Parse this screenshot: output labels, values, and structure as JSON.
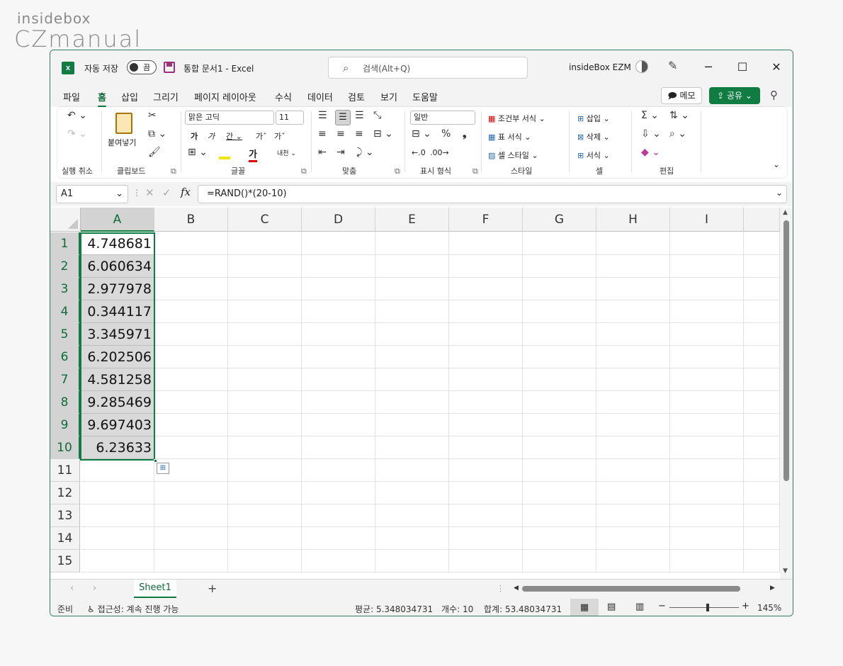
{
  "watermark": {
    "line1": "insidebox",
    "line2": "CZmanual"
  },
  "titlebar": {
    "autosave_label": "자동 저장",
    "autosave_state": "끔",
    "doc_title": "통합 문서1  -  Excel",
    "search_placeholder": "검색(Alt+Q)",
    "user": "insideBox EZM"
  },
  "menu": {
    "items": [
      "파일",
      "홈",
      "삽입",
      "그리기",
      "페이지 레이아웃",
      "수식",
      "데이터",
      "검토",
      "보기",
      "도움말"
    ],
    "active": "홈",
    "memo_label": "메모",
    "share_label": "공유"
  },
  "ribbon": {
    "paste_label": "붙여넣기",
    "font_name": "맑은 고딕",
    "font_size": "11",
    "number_format": "일반",
    "conditional_format": "조건부 서식",
    "table_format": "표 서식",
    "cell_style": "셀 스타일",
    "insert": "삽입",
    "delete": "삭제",
    "format": "서식",
    "groups": [
      "실행 취소",
      "클립보드",
      "글꼴",
      "맞춤",
      "표시 형식",
      "스타일",
      "셀",
      "편집"
    ]
  },
  "formula_bar": {
    "name_box": "A1",
    "formula": "=RAND()*(20-10)"
  },
  "grid": {
    "columns": [
      "A",
      "B",
      "C",
      "D",
      "E",
      "F",
      "G",
      "H",
      "I"
    ],
    "rows": [
      "1",
      "2",
      "3",
      "4",
      "5",
      "6",
      "7",
      "8",
      "9",
      "10",
      "11",
      "12",
      "13",
      "14",
      "15"
    ],
    "a_values": [
      "4.748681",
      "6.060634",
      "2.977978",
      "0.344117",
      "3.345971",
      "6.202506",
      "4.581258",
      "9.285469",
      "9.697403",
      "6.23633"
    ]
  },
  "sheets": {
    "tabs": [
      "Sheet1"
    ],
    "active": "Sheet1"
  },
  "status": {
    "ready": "준비",
    "accessibility": "접근성: 계속 진행 가능",
    "average": "평균: 5.348034731",
    "count": "개수: 10",
    "sum": "합계: 53.48034731",
    "zoom": "145%"
  },
  "colors": {
    "accent": "#107c41",
    "selection_fill": "#d9d9d9"
  }
}
